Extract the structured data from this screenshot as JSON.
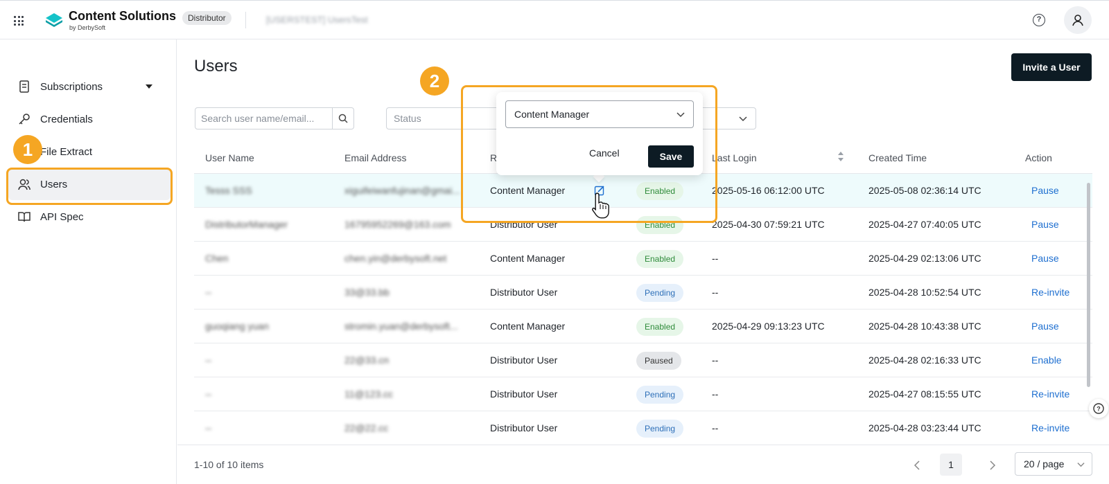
{
  "app": {
    "brand_name": "Content Solutions",
    "brand_sub": "by DerbySoft",
    "role_tag": "Distributor",
    "environment": "[USERSTEST] UsersTest",
    "accent_color": "#f5a623",
    "help_icon": "help-circle-icon",
    "avatar_icon": "user-icon"
  },
  "sidebar": {
    "items": [
      {
        "label": "Subscriptions",
        "icon": "document-icon"
      },
      {
        "label": "Credentials",
        "icon": "key-icon"
      },
      {
        "label": "File Extract",
        "icon": "file-icon"
      },
      {
        "label": "Users",
        "icon": "users-icon"
      },
      {
        "label": "API Spec",
        "icon": "book-icon"
      }
    ]
  },
  "annotations": {
    "step1": "1",
    "step2": "2"
  },
  "main": {
    "title": "Users",
    "invite_label": "Invite a User",
    "search_placeholder": "Search user name/email...",
    "status_placeholder": "Status"
  },
  "table": {
    "headers": [
      "User Name",
      "Email Address",
      "R",
      "Last Login",
      "Created Time",
      "Action"
    ],
    "rows": [
      {
        "name": "Tesss SSS",
        "email": "xiguifeiwanfujinan@gmai...",
        "role": "Content Manager",
        "status": "Enabled",
        "last_login": "2025-05-16 06:12:00 UTC",
        "created": "2025-05-08 02:36:14 UTC",
        "action": "Pause"
      },
      {
        "name": "DistributorManager",
        "email": "16795952269@163.com",
        "role": "Distributor User",
        "status": "Enabled",
        "last_login": "2025-04-30 07:59:21 UTC",
        "created": "2025-04-27 07:40:05 UTC",
        "action": "Pause"
      },
      {
        "name": "Chen",
        "email": "chen.yin@derbysoft.net",
        "role": "Content Manager",
        "status": "Enabled",
        "last_login": "--",
        "created": "2025-04-29 02:13:06 UTC",
        "action": "Pause"
      },
      {
        "name": "--",
        "email": "33@33.bb",
        "role": "Distributor User",
        "status": "Pending",
        "last_login": "--",
        "created": "2025-04-28 10:52:54 UTC",
        "action": "Re-invite"
      },
      {
        "name": "guoqiang yuan",
        "email": "stromin.yuan@derbysoft...",
        "role": "Content Manager",
        "status": "Enabled",
        "last_login": "2025-04-29 09:13:23 UTC",
        "created": "2025-04-28 10:43:38 UTC",
        "action": "Pause"
      },
      {
        "name": "--",
        "email": "22@33.cn",
        "role": "Distributor User",
        "status": "Paused",
        "last_login": "--",
        "created": "2025-04-28 02:16:33 UTC",
        "action": "Enable"
      },
      {
        "name": "--",
        "email": "11@123.cc",
        "role": "Distributor User",
        "status": "Pending",
        "last_login": "--",
        "created": "2025-04-27 08:15:55 UTC",
        "action": "Re-invite"
      },
      {
        "name": "--",
        "email": "22@22.cc",
        "role": "Distributor User",
        "status": "Pending",
        "last_login": "--",
        "created": "2025-04-28 03:23:44 UTC",
        "action": "Re-invite"
      }
    ]
  },
  "popover": {
    "selected_role": "Content Manager",
    "cancel_label": "Cancel",
    "save_label": "Save"
  },
  "pagination": {
    "total": "1-10 of 10 items",
    "page": "1",
    "page_size": "20 / page"
  }
}
